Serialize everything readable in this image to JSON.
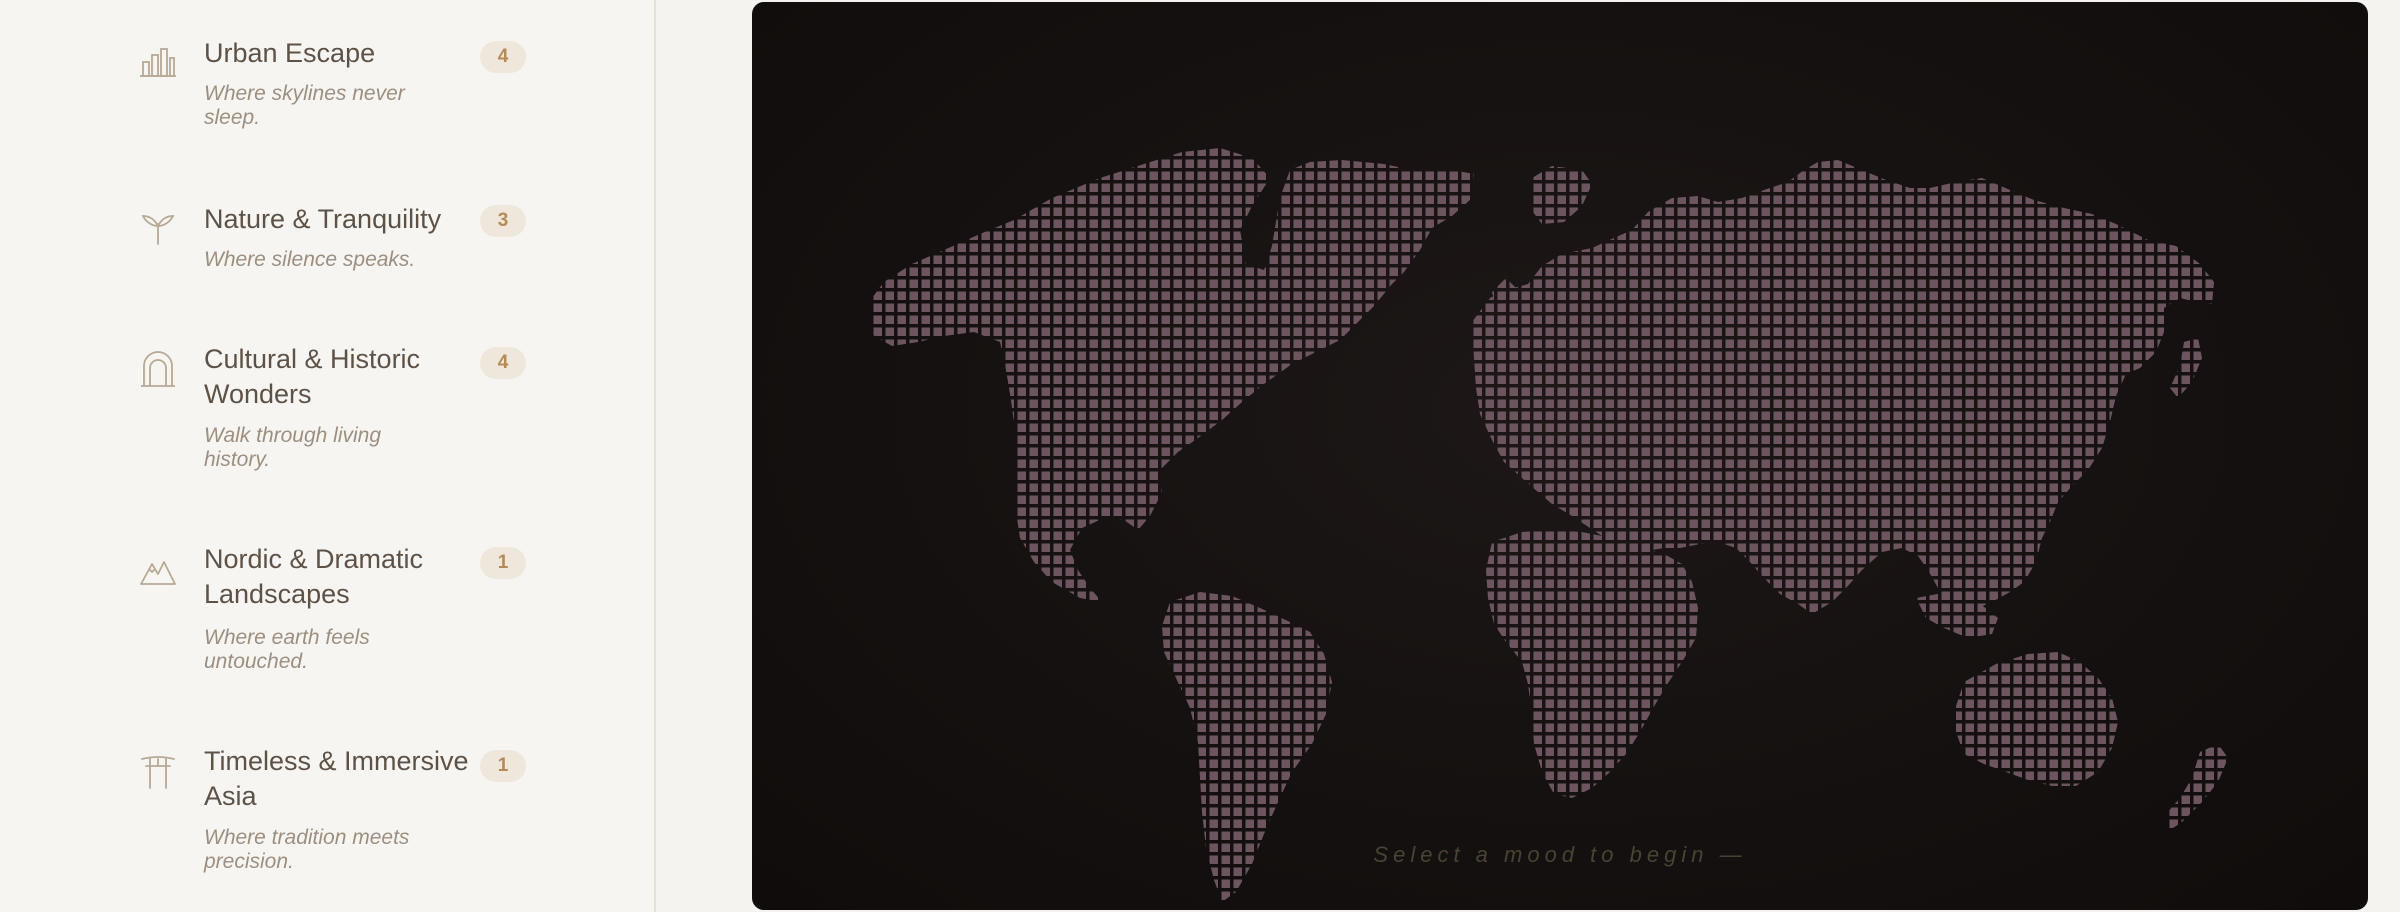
{
  "moods": [
    {
      "title": "Urban Escape",
      "subtitle": "Where skylines never sleep.",
      "count": "4",
      "icon": "city-skyline-icon"
    },
    {
      "title": "Nature & Tranquility",
      "subtitle": "Where silence speaks.",
      "count": "3",
      "icon": "sprout-icon"
    },
    {
      "title": "Cultural & Historic Wonders",
      "subtitle": "Walk through living history.",
      "count": "4",
      "icon": "arch-icon"
    },
    {
      "title": "Nordic & Dramatic Landscapes",
      "subtitle": "Where earth feels untouched.",
      "count": "1",
      "icon": "mountain-icon"
    },
    {
      "title": "Timeless & Immersive Asia",
      "subtitle": "Where tradition meets precision.",
      "count": "1",
      "icon": "torii-gate-icon"
    }
  ],
  "map": {
    "hint": "Select a mood to begin —"
  },
  "colors": {
    "sidebar_bg": "#f7f5f1",
    "title_text": "#5e5247",
    "subtitle_text": "#9d8f80",
    "badge_bg": "#efe7db",
    "badge_text": "#b58a56",
    "map_bg": "#151110",
    "land_dot": "#6d5560",
    "hint_text": "#4a4232"
  }
}
